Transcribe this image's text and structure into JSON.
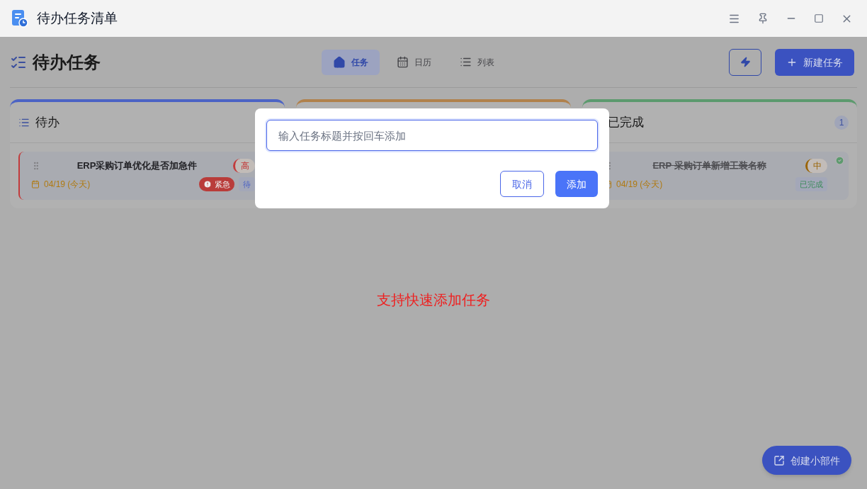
{
  "window": {
    "title": "待办任务清单"
  },
  "header": {
    "title": "待办任务",
    "views": [
      {
        "label": "任务",
        "selected": true
      },
      {
        "label": "日历",
        "selected": false
      },
      {
        "label": "列表",
        "selected": false
      }
    ],
    "new_task_button": "新建任务"
  },
  "columns": [
    {
      "title": "待办",
      "color": "#4c63c4",
      "cards": [
        {
          "title": "ERP采购订单优化是否加急件",
          "priority": {
            "label": "高",
            "color": "#c23b3b"
          },
          "date": "04/19 (今天)",
          "urgent": "紧急",
          "status": {
            "label": "待",
            "color": "#4c63c4"
          },
          "done": false
        }
      ]
    },
    {
      "color": "#b0814c"
    },
    {
      "title": "已完成",
      "color": "#5c9a6e",
      "count": "1",
      "cards": [
        {
          "title": "ERP 采购订单新增工装名称",
          "priority": {
            "label": "中",
            "color": "#9a6406"
          },
          "date": "04/19 (今天)",
          "status": {
            "label": "已完成",
            "color": "#3a8a58"
          },
          "done": true
        }
      ]
    }
  ],
  "dialog": {
    "placeholder": "输入任务标题并按回车添加",
    "cancel": "取消",
    "confirm": "添加"
  },
  "caption": "支持快速添加任务",
  "widget_button": "创建小部件"
}
